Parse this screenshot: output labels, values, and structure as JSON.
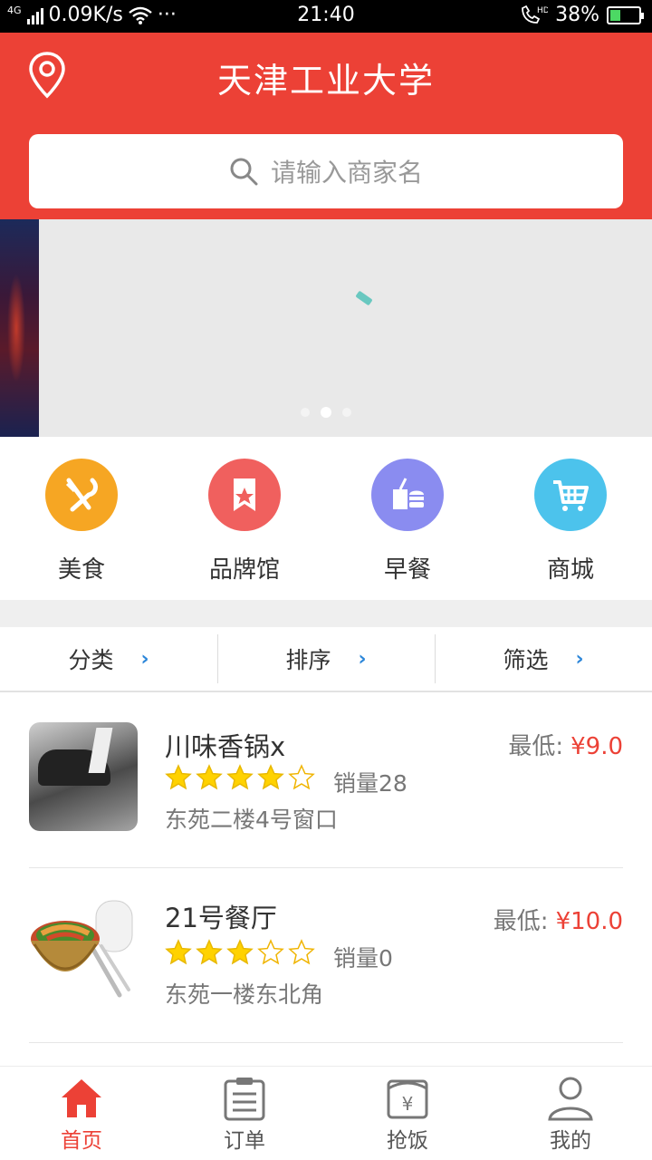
{
  "status_bar": {
    "network": "4G",
    "speed": "0.09K/s",
    "more": "···",
    "time": "21:40",
    "hd": "HD",
    "battery": "38%",
    "battery_level": 0.38
  },
  "header": {
    "title": "天津工业大学",
    "search_placeholder": "请输入商家名"
  },
  "banner": {
    "page_count": 3,
    "active_index": 1
  },
  "categories": [
    {
      "label": "美食",
      "icon": "fork-knife-icon",
      "color": "#f6a623"
    },
    {
      "label": "品牌馆",
      "icon": "brand-star-icon",
      "color": "#f0605e"
    },
    {
      "label": "早餐",
      "icon": "breakfast-icon",
      "color": "#8a8cf0"
    },
    {
      "label": "商城",
      "icon": "cart-icon",
      "color": "#4cc3ec"
    }
  ],
  "filters": [
    {
      "label": "分类"
    },
    {
      "label": "排序"
    },
    {
      "label": "筛选"
    }
  ],
  "shops": [
    {
      "name": "川味香锅x",
      "rating": 4,
      "sales": "销量28",
      "address": "东苑二楼4号窗口",
      "price_label": "最低:",
      "price": "¥9.0"
    },
    {
      "name": "21号餐厅",
      "rating": 3,
      "sales": "销量0",
      "address": "东苑一楼东北角",
      "price_label": "最低:",
      "price": "¥10.0"
    }
  ],
  "nav": [
    {
      "label": "首页",
      "icon": "home-icon",
      "active": true
    },
    {
      "label": "订单",
      "icon": "order-icon",
      "active": false
    },
    {
      "label": "抢饭",
      "icon": "grab-meal-icon",
      "active": false
    },
    {
      "label": "我的",
      "icon": "profile-icon",
      "active": false
    }
  ],
  "colors": {
    "brand": "#ec4136",
    "link_blue": "#2b86d9",
    "star": "#ffd200"
  }
}
